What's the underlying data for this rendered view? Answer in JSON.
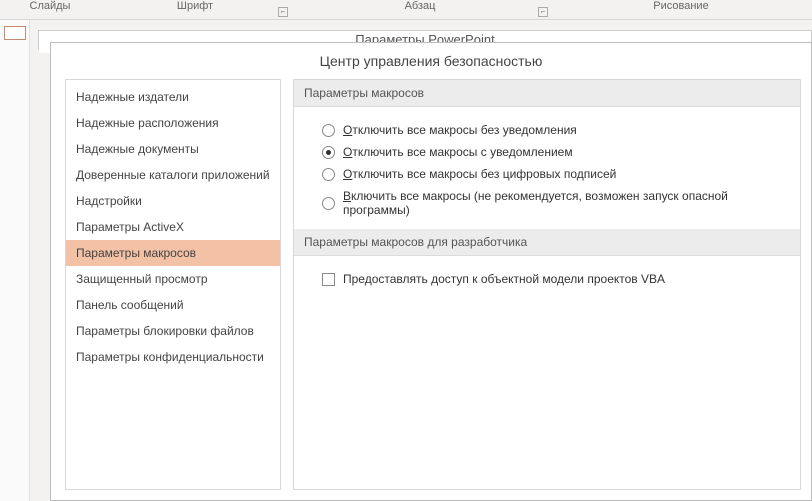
{
  "ribbon": {
    "slides": "Слайды",
    "font": "Шрифт",
    "paragraph": "Абзац",
    "drawing": "Рисование"
  },
  "parent_dialog_title": "Параметры PowerPoint",
  "dialog": {
    "title": "Центр управления безопасностью",
    "sidebar": {
      "items": [
        "Надежные издатели",
        "Надежные расположения",
        "Надежные документы",
        "Доверенные каталоги приложений",
        "Надстройки",
        "Параметры ActiveX",
        "Параметры макросов",
        "Защищенный просмотр",
        "Панель сообщений",
        "Параметры блокировки файлов",
        "Параметры конфиденциальности"
      ],
      "selected_index": 6
    },
    "sections": {
      "macro_settings": {
        "header": "Параметры макросов",
        "options": [
          "Отключить все макросы без уведомления",
          "Отключить все макросы с уведомлением",
          "Отключить все макросы без цифровых подписей",
          "Включить все макросы (не рекомендуется, возможен запуск опасной программы)"
        ],
        "selected": 1
      },
      "dev_settings": {
        "header": "Параметры макросов для разработчика",
        "checkbox_label": "Предоставлять доступ к объектной модели проектов VBA",
        "checked": false
      }
    }
  }
}
